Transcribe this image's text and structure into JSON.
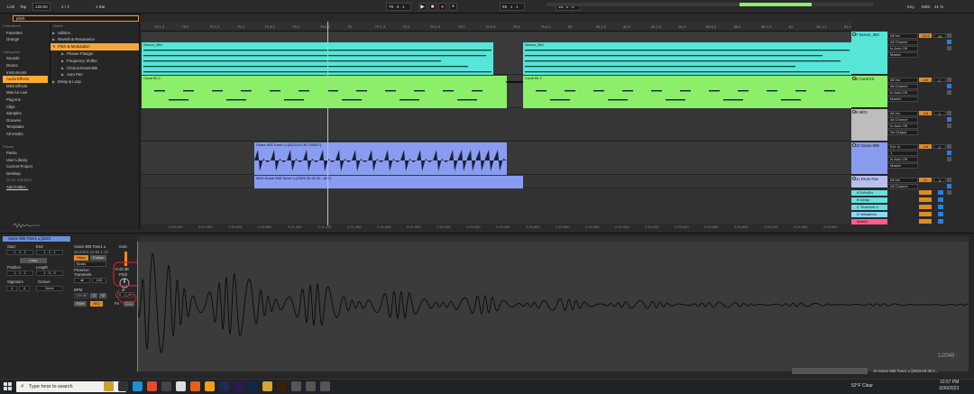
{
  "colors": {
    "accent": "#ffab2e",
    "serum": "#56e6d8",
    "coral": "#8bef6a",
    "snare": "#8a9cf0",
    "master": "#ff5d8f",
    "ret_a": "#66e0e0",
    "ret_d": "#8bd7ff"
  },
  "topbar": {
    "link": "Link",
    "tap": "Tap",
    "tempo": "133.00",
    "sig": "4 / 4",
    "loop_len": "1 Bar",
    "position": "79 . 3 . 1",
    "loop_start": "65 . 1 . 1",
    "loop_length": "18 . 0 . 0",
    "key": "Key",
    "midi": "MIDI",
    "cpu": "21 %"
  },
  "browser": {
    "search": "pitch",
    "collections_head": "Collections",
    "collections": [
      "Favorites",
      "Orange"
    ],
    "categories_head": "Categories",
    "categories": [
      "Sounds",
      "Drums",
      "Instruments",
      "Audio Effects",
      "MIDI Effects",
      "Max for Live",
      "Plug-Ins",
      "Clips",
      "Samples",
      "Grooves",
      "Templates",
      "All results"
    ],
    "places_head": "Places",
    "places": [
      "Packs",
      "User Library",
      "Current Project",
      "Desktop",
      "Drum Samples",
      "Add Folder..."
    ],
    "name_head": "Name",
    "folders": [
      "Utilities",
      "Reverb & Resonance",
      "Pitch & Modulation",
      "Phaser-Flanger",
      "Frequency Shifter",
      "Chorus-Ensemble",
      "Auto Pan",
      "Delay & Loop"
    ]
  },
  "ruler": [
    "79.1.3",
    "79.2",
    "79.2.3",
    "79.3",
    "79.3.3",
    "79.4",
    "79.4.3",
    "79",
    "79.1.3",
    "79.2",
    "79.2.3",
    "79.3",
    "79.3.3",
    "79.4",
    "79.4.3",
    "80",
    "80.1.3",
    "80.2",
    "80.2.3",
    "80.3",
    "80.3.3",
    "80.4",
    "80.4.3",
    "81",
    "81.1.3",
    "81.2"
  ],
  "timeline": [
    "2:20.200",
    "2:20.400",
    "2:20.600",
    "2:20.800",
    "2:21.000",
    "2:21.200",
    "2:21.400",
    "2:21.600",
    "2:21.800",
    "2:22.000",
    "2:22.200",
    "2:22.400",
    "2:22.600",
    "2:22.800",
    "2:23.000",
    "2:23.200",
    "2:23.400",
    "2:23.600",
    "2:23.800",
    "2:24.000",
    "2:24.200",
    "2:24.400",
    "2:24.600"
  ],
  "clips": {
    "serum_a": "Serum_384",
    "serum_b": "Serum_384",
    "coral_a": "Coral Kit 2",
    "coral_b": "Coral Kit 2",
    "snare_audio": "Snare 808 Tone1 u [2023-03-30 225807]",
    "snare_midi": "MIDI Snare 808 Tone1 u [2023-03-30 22...807]"
  },
  "tracks": [
    {
      "name": "7 Serum_384",
      "in": "All Ins",
      "ch": "All Channe",
      "mon": "In Auto Off",
      "out": "Master",
      "vol": "-23.6",
      "pan": "26"
    },
    {
      "name": "8 Coral Kit",
      "in": "All Ins",
      "ch": "All Channe",
      "mon": "In Auto Off",
      "out": "Master",
      "vol": "-inf",
      "pan": "C"
    },
    {
      "name": "9 MIDI",
      "in": "All Ins",
      "ch": "All Channe",
      "mon": "In Auto Off",
      "out": "No Output",
      "vol": "-inf",
      "pan": "C"
    },
    {
      "name": "10 Snare 808",
      "in": "Ext. In",
      "ch": "1",
      "mon": "In Auto Off",
      "out": "Master",
      "vol": "-inf",
      "pan": "C"
    },
    {
      "name": "11 Drum Rac",
      "in": "All Ins",
      "ch": "All Channe",
      "mon": "",
      "out": "",
      "vol": "11",
      "pan": "0"
    }
  ],
  "returns": [
    "A SchoRo",
    "B Delay",
    "C TrueVerb II",
    "D VahalaVin",
    "Master"
  ],
  "set_label": "Set",
  "detail": {
    "clip_title": "Snare 808 Tone1 u [2023",
    "start": "Start",
    "end": "End",
    "loop": "Loop",
    "position": "Position",
    "length": "Length",
    "signature": "Signature",
    "groove": "Groove",
    "sig_num": "4",
    "sig_den": "4",
    "sample_name": "Snare 808 Tone1 u",
    "sample_info": "48.0 kHz 24 Bit 1 Ch",
    "warp": "Warp",
    "follow": "Follow",
    "beats": "Beats",
    "preserve": "Preserve",
    "transients": "Transients",
    "bpm": "BPM",
    "bpm_val": "133.00",
    "half": ":2",
    "dbl": "*2",
    "ram": "RAM",
    "hiq": "HiQ",
    "gain": "Gain",
    "gain_val": "-0.43 dB",
    "pitch": "Pitch",
    "st": "st",
    "cents": "0",
    "edit": "Edit",
    "fade": "Fa"
  },
  "wave_footer": "1/2048",
  "status_clip": "10-Snare 808 Tone1 u [2023-03-30 2...",
  "taskbar": {
    "search": "Type here to search",
    "weather": "52°F Clear",
    "time": "10:57 PM",
    "date": "3/30/2023"
  }
}
